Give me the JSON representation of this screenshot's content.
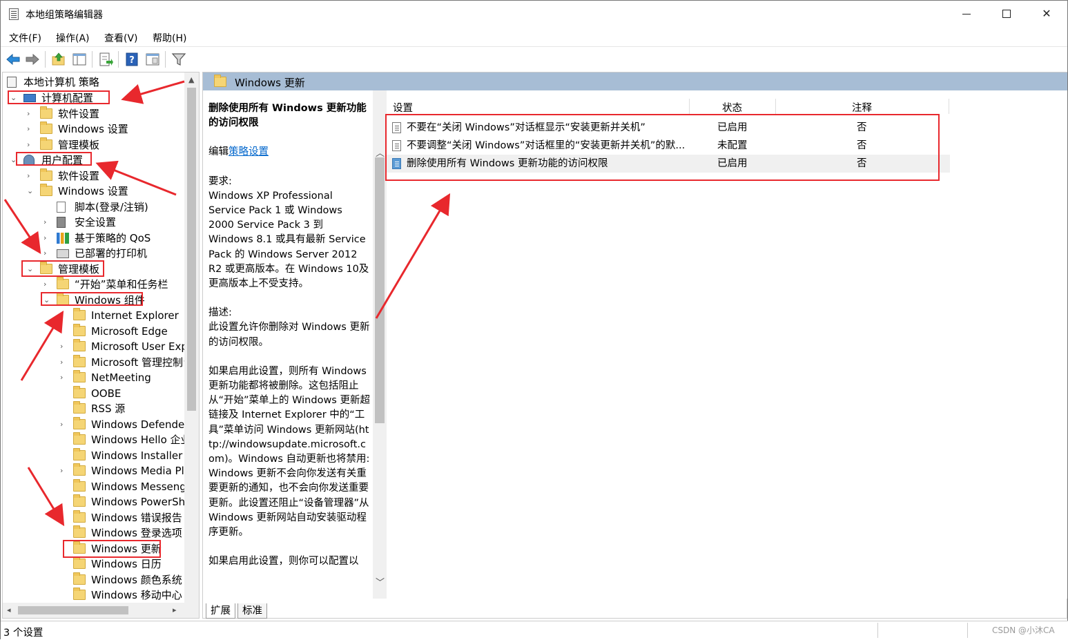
{
  "window": {
    "title": "本地组策略编辑器",
    "controls": {
      "minimize_icon": "minimize-icon",
      "maximize_icon": "maximize-icon",
      "close_glyph": "✕"
    }
  },
  "menu": [
    "文件(F)",
    "操作(A)",
    "查看(V)",
    "帮助(H)"
  ],
  "toolbar": {
    "icons": [
      "back-arrow-icon",
      "forward-arrow-icon",
      "up-folder-icon",
      "show-hide-tree-icon",
      "export-list-icon",
      "help-icon",
      "properties-icon",
      "filter-icon"
    ]
  },
  "tree": {
    "root": "本地计算机 策略",
    "items": [
      {
        "label": "计算机配置",
        "expander": "⌄"
      },
      {
        "label": "软件设置",
        "expander": "›"
      },
      {
        "label": "Windows 设置",
        "expander": "›"
      },
      {
        "label": "管理模板",
        "expander": "›"
      },
      {
        "label": "用户配置",
        "expander": "⌄"
      },
      {
        "label": "软件设置",
        "expander": "›"
      },
      {
        "label": "Windows 设置",
        "expander": "⌄"
      },
      {
        "label": "脚本(登录/注销)",
        "expander": ""
      },
      {
        "label": "安全设置",
        "expander": "›"
      },
      {
        "label": "基于策略的 QoS",
        "expander": "›"
      },
      {
        "label": "已部署的打印机",
        "expander": "›"
      },
      {
        "label": "管理模板",
        "expander": "⌄"
      },
      {
        "label": "“开始”菜单和任务栏",
        "expander": "›"
      },
      {
        "label": "Windows 组件",
        "expander": "⌄"
      },
      {
        "label": "Internet Explorer",
        "expander": "›"
      },
      {
        "label": "Microsoft Edge",
        "expander": ""
      },
      {
        "label": "Microsoft User Expe",
        "expander": "›"
      },
      {
        "label": "Microsoft 管理控制台",
        "expander": "›"
      },
      {
        "label": "NetMeeting",
        "expander": "›"
      },
      {
        "label": "OOBE",
        "expander": ""
      },
      {
        "label": "RSS 源",
        "expander": ""
      },
      {
        "label": "Windows Defender",
        "expander": "›"
      },
      {
        "label": "Windows Hello 企业",
        "expander": ""
      },
      {
        "label": "Windows Installer",
        "expander": ""
      },
      {
        "label": "Windows Media Play",
        "expander": "›"
      },
      {
        "label": "Windows Messenge",
        "expander": ""
      },
      {
        "label": "Windows PowerShe",
        "expander": ""
      },
      {
        "label": "Windows 错误报告",
        "expander": "›"
      },
      {
        "label": "Windows 登录选项",
        "expander": ""
      },
      {
        "label": "Windows 更新",
        "expander": ""
      },
      {
        "label": "Windows 日历",
        "expander": ""
      },
      {
        "label": "Windows 颜色系统",
        "expander": ""
      },
      {
        "label": "Windows 移动中心",
        "expander": ""
      }
    ]
  },
  "section": {
    "title": "Windows 更新"
  },
  "description": {
    "title": "删除使用所有 Windows 更新功能的访问权限",
    "edit_prefix": "编辑",
    "edit_link": "策略设置",
    "requirements_label": "要求:",
    "requirements": "Windows XP Professional Service Pack 1 或 Windows 2000 Service Pack 3 到 Windows 8.1 或具有最新 Service Pack 的 Windows Server 2012 R2 或更高版本。在 Windows 10及更高版本上不受支持。",
    "description_label": "描述:",
    "description_text": "此设置允许你删除对 Windows 更新的访问权限。",
    "paragraph": "如果启用此设置，则所有 Windows 更新功能都将被删除。这包括阻止从“开始”菜单上的 Windows 更新超链接及 Internet Explorer 中的“工具”菜单访问 Windows 更新网站(http://windowsupdate.microsoft.com)。Windows 自动更新也将禁用: Windows 更新不会向你发送有关重要更新的通知，也不会向你发送重要更新。此设置还阻止“设备管理器”从 Windows 更新网站自动安装驱动程序更新。",
    "paragraph_cut": "如果启用此设置，则你可以配置以"
  },
  "list": {
    "columns": [
      "设置",
      "状态",
      "注释"
    ],
    "rows": [
      {
        "setting": "不要在“关闭 Windows”对话框显示“安装更新并关机”",
        "state": "已启用",
        "comment": "否"
      },
      {
        "setting": "不要调整“关闭 Windows”对话框里的“安装更新并关机”的默...",
        "state": "未配置",
        "comment": "否"
      },
      {
        "setting": "删除使用所有 Windows 更新功能的访问权限",
        "state": "已启用",
        "comment": "否"
      }
    ]
  },
  "tabs": [
    "扩展",
    "标准"
  ],
  "status": {
    "text": "3 个设置"
  },
  "watermark": "CSDN @小沐CA",
  "colors": {
    "annotation": "#e8282d",
    "header": "#a7bdd5",
    "link": "#0066cc"
  }
}
